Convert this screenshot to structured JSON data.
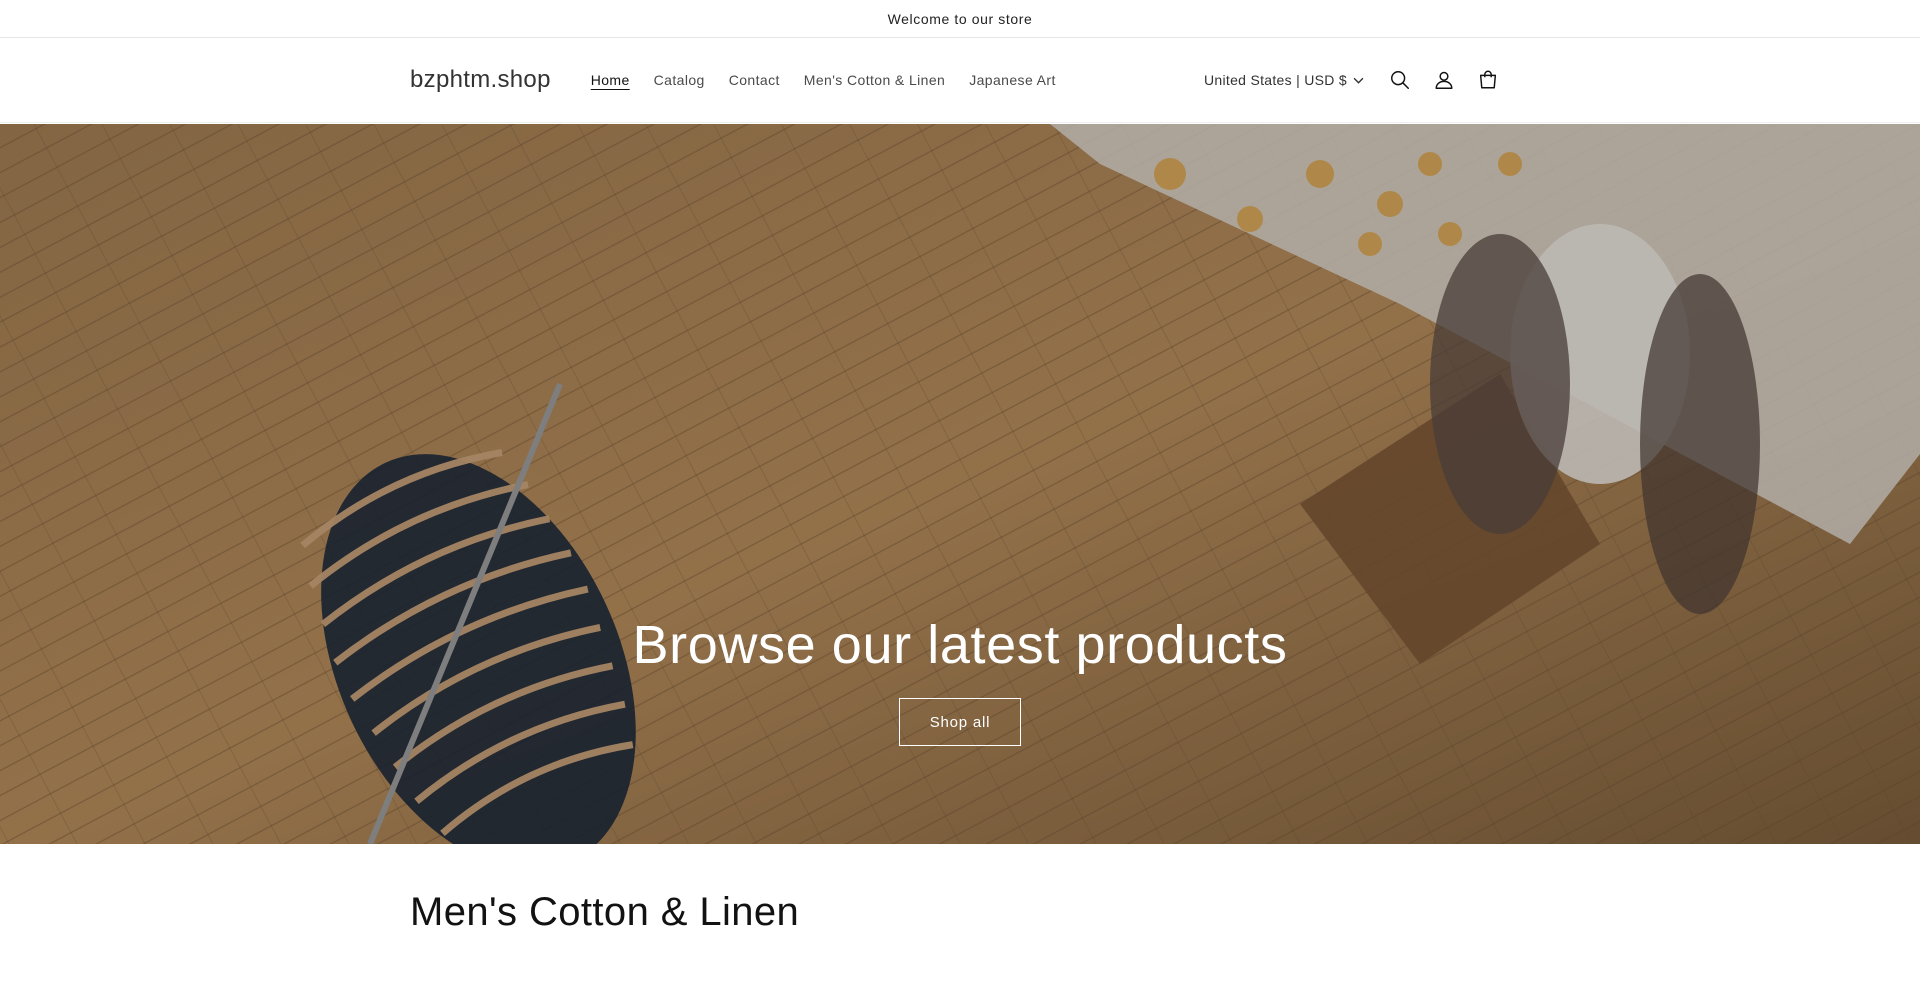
{
  "announcement": {
    "text": "Welcome to our store"
  },
  "header": {
    "logo": "bzphtm.shop",
    "nav": [
      {
        "label": "Home",
        "active": true
      },
      {
        "label": "Catalog"
      },
      {
        "label": "Contact"
      },
      {
        "label": "Men's Cotton & Linen"
      },
      {
        "label": "Japanese Art"
      }
    ],
    "country_selector": "United States | USD $",
    "icons": [
      "search-icon",
      "account-icon",
      "cart-icon"
    ]
  },
  "hero": {
    "title": "Browse our latest products",
    "button_label": "Shop all"
  },
  "collection": {
    "title": "Men's Cotton & Linen"
  }
}
